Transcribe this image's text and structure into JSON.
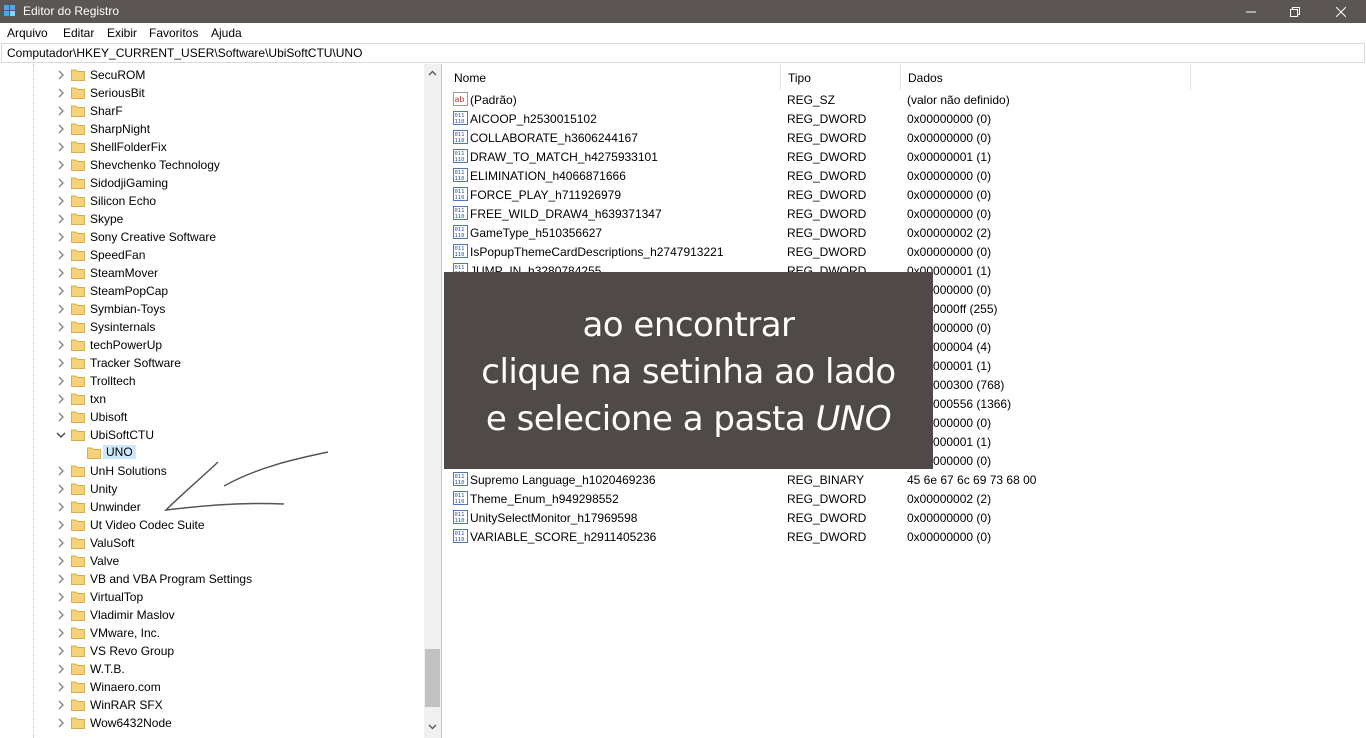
{
  "window": {
    "title": "Editor do Registro"
  },
  "menu": [
    "Arquivo",
    "Editar",
    "Exibir",
    "Favoritos",
    "Ajuda"
  ],
  "address": "Computador\\HKEY_CURRENT_USER\\Software\\UbiSoftCTU\\UNO",
  "tree": {
    "items": [
      {
        "label": "SecuROM",
        "expanded": false
      },
      {
        "label": "SeriousBit",
        "expanded": false
      },
      {
        "label": "SharF",
        "expanded": false
      },
      {
        "label": "SharpNight",
        "expanded": false
      },
      {
        "label": "ShellFolderFix",
        "expanded": false
      },
      {
        "label": "Shevchenko Technology",
        "expanded": false
      },
      {
        "label": "SidodjiGaming",
        "expanded": false
      },
      {
        "label": "Silicon Echo",
        "expanded": false
      },
      {
        "label": "Skype",
        "expanded": false
      },
      {
        "label": "Sony Creative Software",
        "expanded": false
      },
      {
        "label": "SpeedFan",
        "expanded": false
      },
      {
        "label": "SteamMover",
        "expanded": false
      },
      {
        "label": "SteamPopCap",
        "expanded": false
      },
      {
        "label": "Symbian-Toys",
        "expanded": false
      },
      {
        "label": "Sysinternals",
        "expanded": false
      },
      {
        "label": "techPowerUp",
        "expanded": false
      },
      {
        "label": "Tracker Software",
        "expanded": false
      },
      {
        "label": "Trolltech",
        "expanded": false
      },
      {
        "label": "txn",
        "expanded": false
      },
      {
        "label": "Ubisoft",
        "expanded": false
      },
      {
        "label": "UbiSoftCTU",
        "expanded": true
      },
      {
        "label": "UNO",
        "child": true,
        "selected": true
      },
      {
        "label": "UnH Solutions",
        "expanded": false
      },
      {
        "label": "Unity",
        "expanded": false
      },
      {
        "label": "Unwinder",
        "expanded": false
      },
      {
        "label": "Ut Video Codec Suite",
        "expanded": false
      },
      {
        "label": "ValuSoft",
        "expanded": false
      },
      {
        "label": "Valve",
        "expanded": false
      },
      {
        "label": "VB and VBA Program Settings",
        "expanded": false
      },
      {
        "label": "VirtualTop",
        "expanded": false
      },
      {
        "label": "Vladimir Maslov",
        "expanded": false
      },
      {
        "label": "VMware, Inc.",
        "expanded": false
      },
      {
        "label": "VS Revo Group",
        "expanded": false
      },
      {
        "label": "W.T.B.",
        "expanded": false
      },
      {
        "label": "Winaero.com",
        "expanded": false
      },
      {
        "label": "WinRAR SFX",
        "expanded": false
      },
      {
        "label": "Wow6432Node",
        "expanded": false
      }
    ]
  },
  "list": {
    "columns": [
      "Nome",
      "Tipo",
      "Dados"
    ],
    "rows": [
      {
        "name": "(Padrão)",
        "type": "REG_SZ",
        "data": "(valor não definido)",
        "icon": "string-value-icon"
      },
      {
        "name": "AICOOP_h2530015102",
        "type": "REG_DWORD",
        "data": "0x00000000 (0)",
        "icon": "binary-value-icon"
      },
      {
        "name": "COLLABORATE_h3606244167",
        "type": "REG_DWORD",
        "data": "0x00000000 (0)",
        "icon": "binary-value-icon"
      },
      {
        "name": "DRAW_TO_MATCH_h4275933101",
        "type": "REG_DWORD",
        "data": "0x00000001 (1)",
        "icon": "binary-value-icon"
      },
      {
        "name": "ELIMINATION_h4066871666",
        "type": "REG_DWORD",
        "data": "0x00000000 (0)",
        "icon": "binary-value-icon"
      },
      {
        "name": "FORCE_PLAY_h711926979",
        "type": "REG_DWORD",
        "data": "0x00000000 (0)",
        "icon": "binary-value-icon"
      },
      {
        "name": "FREE_WILD_DRAW4_h639371347",
        "type": "REG_DWORD",
        "data": "0x00000000 (0)",
        "icon": "binary-value-icon"
      },
      {
        "name": "GameType_h510356627",
        "type": "REG_DWORD",
        "data": "0x00000002 (2)",
        "icon": "binary-value-icon"
      },
      {
        "name": "IsPopupThemeCardDescriptions_h2747913221",
        "type": "REG_DWORD",
        "data": "0x00000000 (0)",
        "icon": "binary-value-icon"
      },
      {
        "name": "JUMP_IN_h3280784255",
        "type": "REG_DWORD",
        "data": "0x00000001 (1)",
        "icon": "binary-value-icon"
      },
      {
        "name": "",
        "type": "",
        "data": "0x00000000 (0)",
        "icon": "binary-value-icon"
      },
      {
        "name": "",
        "type": "",
        "data": "0x000000ff (255)",
        "icon": "binary-value-icon"
      },
      {
        "name": "",
        "type": "",
        "data": "0x00000000 (0)",
        "icon": "binary-value-icon"
      },
      {
        "name": "",
        "type": "",
        "data": "0x00000004 (4)",
        "icon": "binary-value-icon"
      },
      {
        "name": "",
        "type": "",
        "data": "0x00000001 (1)",
        "icon": "binary-value-icon"
      },
      {
        "name": "",
        "type": "",
        "data": "0x00000300 (768)",
        "icon": "binary-value-icon"
      },
      {
        "name": "",
        "type": "",
        "data": "0x00000556 (1366)",
        "icon": "binary-value-icon"
      },
      {
        "name": "",
        "type": "",
        "data": "0x00000000 (0)",
        "icon": "binary-value-icon"
      },
      {
        "name": "",
        "type": "",
        "data": "0x00000001 (1)",
        "icon": "binary-value-icon"
      },
      {
        "name": "",
        "type": "",
        "data": "0x00000000 (0)",
        "icon": "binary-value-icon"
      },
      {
        "name": "Supremo Language_h1020469236",
        "type": "REG_BINARY",
        "data": "45 6e 67 6c 69 73 68 00",
        "icon": "binary-value-icon"
      },
      {
        "name": "Theme_Enum_h949298552",
        "type": "REG_DWORD",
        "data": "0x00000002 (2)",
        "icon": "binary-value-icon"
      },
      {
        "name": "UnitySelectMonitor_h17969598",
        "type": "REG_DWORD",
        "data": "0x00000000 (0)",
        "icon": "binary-value-icon"
      },
      {
        "name": "VARIABLE_SCORE_h2911405236",
        "type": "REG_DWORD",
        "data": "0x00000000 (0)",
        "icon": "binary-value-icon"
      }
    ]
  },
  "overlay": {
    "line1": "ao encontrar",
    "line2": "clique na setinha ao lado",
    "line3": "e selecione a pasta",
    "line3_em": "UNO"
  },
  "colors": {
    "titlebar": "#5b5653",
    "overlay": "#4f4a48",
    "selection": "#cce8ff",
    "folder": "#f6d37a"
  }
}
